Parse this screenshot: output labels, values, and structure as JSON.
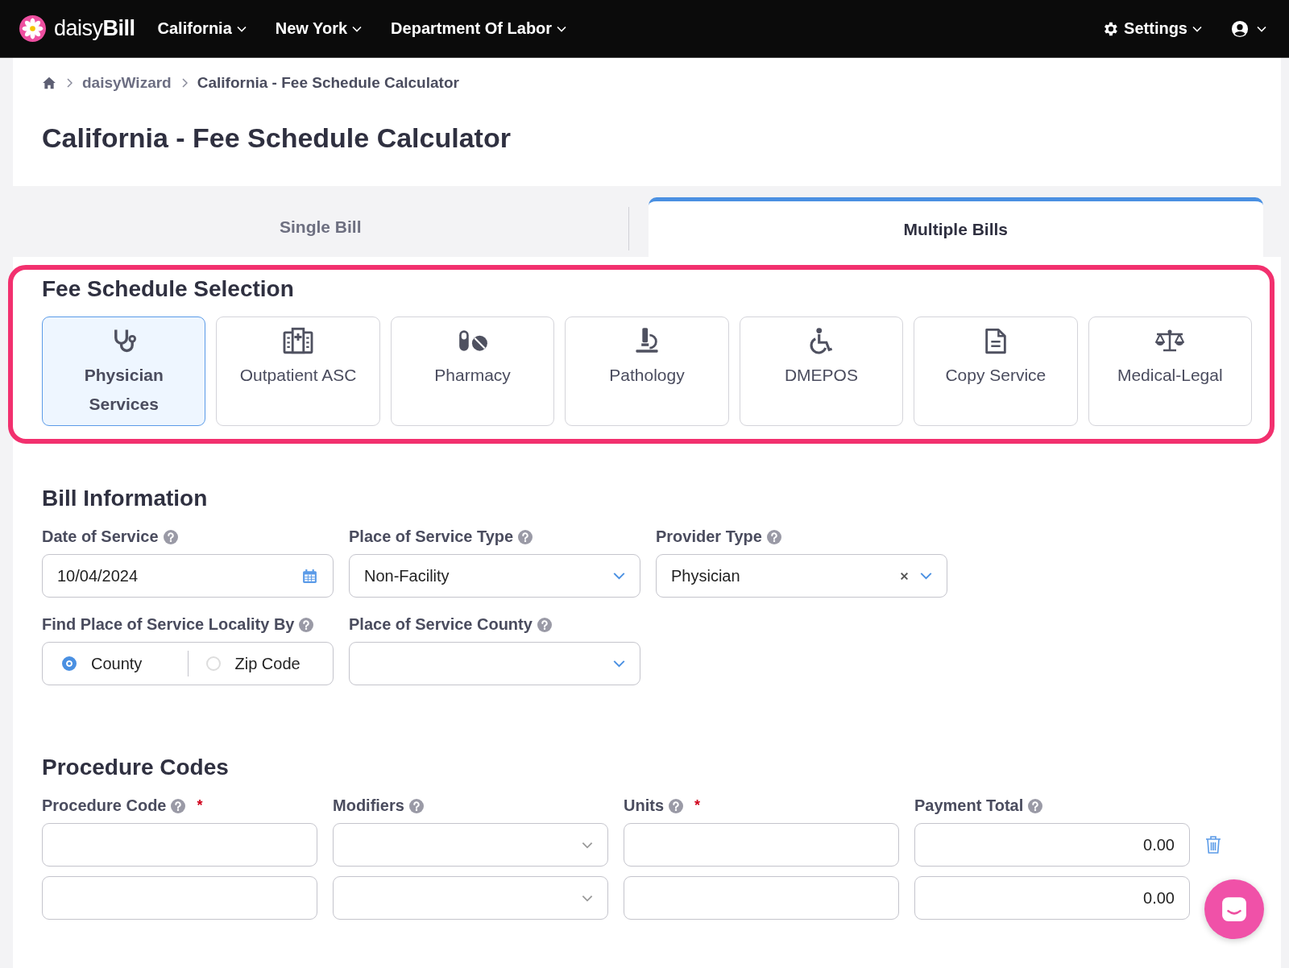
{
  "navbar": {
    "brand": {
      "light": "daisy",
      "bold": "Bill"
    },
    "menus": [
      "California",
      "New York",
      "Department Of Labor"
    ],
    "settings": "Settings"
  },
  "breadcrumb": [
    "daisyWizard",
    "California - Fee Schedule Calculator"
  ],
  "page_title": "California - Fee Schedule Calculator",
  "tabs": [
    {
      "label": "Single Bill",
      "selected": false
    },
    {
      "label": "Multiple Bills",
      "selected": true
    }
  ],
  "fee_schedule": {
    "title": "Fee Schedule Selection",
    "highlighted": true,
    "options": [
      {
        "label": "Physician Services",
        "selected": true
      },
      {
        "label": "Outpatient ASC",
        "selected": false
      },
      {
        "label": "Pharmacy",
        "selected": false
      },
      {
        "label": "Pathology",
        "selected": false
      },
      {
        "label": "DMEPOS",
        "selected": false
      },
      {
        "label": "Copy Service",
        "selected": false
      },
      {
        "label": "Medical-Legal",
        "selected": false
      }
    ]
  },
  "bill_information": {
    "title": "Bill Information",
    "date_of_service": {
      "label": "Date of Service",
      "value": "10/04/2024"
    },
    "place_of_service_type": {
      "label": "Place of Service Type",
      "value": "Non-Facility"
    },
    "provider_type": {
      "label": "Provider Type",
      "value": "Physician"
    },
    "locality_by": {
      "label": "Find Place of Service Locality By",
      "options": [
        {
          "label": "County",
          "selected": true
        },
        {
          "label": "Zip Code",
          "selected": false
        }
      ]
    },
    "place_of_service_county": {
      "label": "Place of Service County"
    }
  },
  "procedure_codes": {
    "title": "Procedure Codes",
    "columns": [
      {
        "label": "Procedure Code",
        "required_mark": "*"
      },
      {
        "label": "Modifiers"
      },
      {
        "label": "Units",
        "required_mark": "*"
      },
      {
        "label": "Payment Total"
      }
    ],
    "rows": [
      {
        "payment_total": "0.00"
      },
      {
        "payment_total": "0.00"
      }
    ]
  }
}
